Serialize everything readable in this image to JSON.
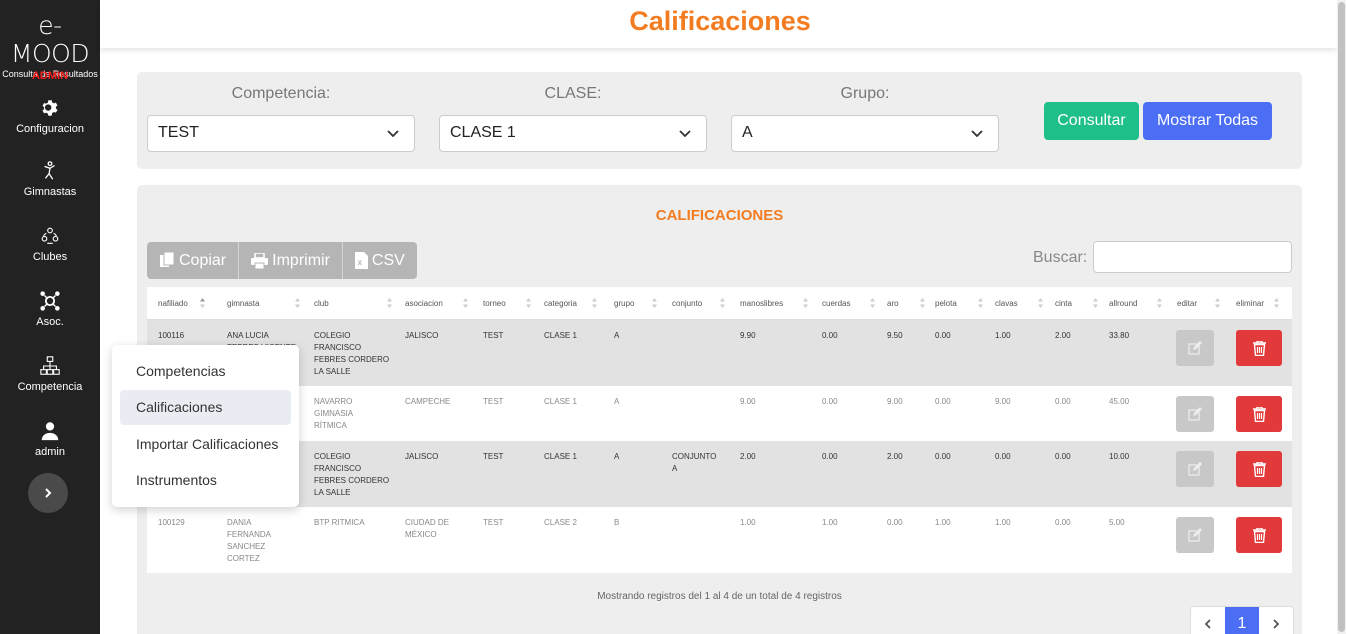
{
  "sidebar": {
    "logo": "e-MOOD",
    "logo_sub": "Consulta de Resultados",
    "role": "ADMIN",
    "items": [
      {
        "label": "Configuracion",
        "icon": "gear-icon"
      },
      {
        "label": "Gimnastas",
        "icon": "gymnast-icon"
      },
      {
        "label": "Clubes",
        "icon": "clubs-icon"
      },
      {
        "label": "Asoc.",
        "icon": "association-icon"
      },
      {
        "label": "Competencia",
        "icon": "hierarchy-icon"
      },
      {
        "label": "admin",
        "icon": "user-icon"
      }
    ],
    "toggle_icon": "chevron-right-icon"
  },
  "header": {
    "title": "Calificaciones"
  },
  "filters": {
    "competencia": {
      "label": "Competencia:",
      "value": "TEST"
    },
    "clase": {
      "label": "CLASE:",
      "value": "CLASE 1"
    },
    "grupo": {
      "label": "Grupo:",
      "value": "A"
    },
    "consultar": "Consultar",
    "mostrar": "Mostrar Todas"
  },
  "results": {
    "title": "CALIFICACIONES",
    "export": {
      "copy": "Copiar",
      "print": "Imprimir",
      "csv": "CSV"
    },
    "search_label": "Buscar:",
    "columns": [
      "nafiliado",
      "gimnasta",
      "club",
      "asociacion",
      "torneo",
      "categoria",
      "grupo",
      "conjunto",
      "manoslibres",
      "cuerdas",
      "aro",
      "pelota",
      "clavas",
      "cinta",
      "allround",
      "editar",
      "eliminar"
    ],
    "rows": [
      {
        "nafiliado": "100116",
        "gimnasta": "ANA LUCIA\nFEBRES VICENTE",
        "club": "COLEGIO\nFRANCISCO\nFEBRES CORDERO\nLA SALLE",
        "asociacion": "JALISCO",
        "torneo": "TEST",
        "categoria": "CLASE 1",
        "grupo": "A",
        "conjunto": "",
        "manoslibres": "9.90",
        "cuerdas": "0.00",
        "aro": "9.50",
        "pelota": "0.00",
        "clavas": "1.00",
        "cinta": "2.00",
        "allround": "33.80"
      },
      {
        "nafiliado": "",
        "gimnasta": "",
        "club": "NAVARRO\nGIMNASIA\nRÍTMICA",
        "asociacion": "CAMPECHE",
        "torneo": "TEST",
        "categoria": "CLASE 1",
        "grupo": "A",
        "conjunto": "",
        "manoslibres": "9.00",
        "cuerdas": "0.00",
        "aro": "9.00",
        "pelota": "0.00",
        "clavas": "9.00",
        "cinta": "0.00",
        "allround": "45.00"
      },
      {
        "nafiliado": "",
        "gimnasta": "",
        "club": "COLEGIO\nFRANCISCO\nFEBRES CORDERO\nLA SALLE",
        "asociacion": "JALISCO",
        "torneo": "TEST",
        "categoria": "CLASE 1",
        "grupo": "A",
        "conjunto": "CONJUNTO\nA",
        "manoslibres": "2.00",
        "cuerdas": "0.00",
        "aro": "2.00",
        "pelota": "0.00",
        "clavas": "0.00",
        "cinta": "0.00",
        "allround": "10.00"
      },
      {
        "nafiliado": "100129",
        "gimnasta": "DANIA\nFERNANDA\nSANCHEZ\nCORTEZ",
        "club": "BTP RITMICA",
        "asociacion": "CIUDAD DE\nMÉXICO",
        "torneo": "TEST",
        "categoria": "CLASE 2",
        "grupo": "B",
        "conjunto": "",
        "manoslibres": "1.00",
        "cuerdas": "1.00",
        "aro": "0.00",
        "pelota": "1.00",
        "clavas": "1.00",
        "cinta": "0.00",
        "allround": "5.00"
      }
    ],
    "info": "Mostrando registros del 1 al 4 de un total de 4 registros",
    "page": "1"
  },
  "menu": {
    "items": [
      "Competencias",
      "Calificaciones",
      "Importar Calificaciones",
      "Instrumentos"
    ],
    "active": "Calificaciones"
  },
  "colors": {
    "accent": "#f47c20",
    "sidebar": "#222222",
    "success": "#1fbf8a",
    "primary": "#4c6ef5",
    "danger": "#e23a3a",
    "admin": "#ff1a1a"
  }
}
